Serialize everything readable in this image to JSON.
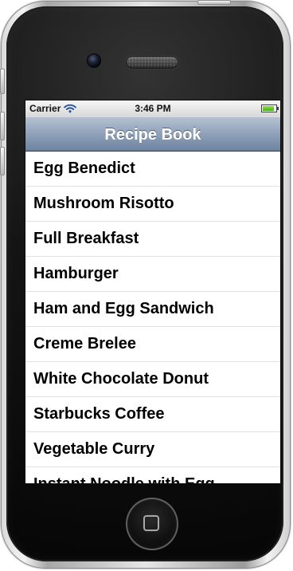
{
  "status_bar": {
    "carrier": "Carrier",
    "time": "3:46 PM",
    "battery_level": 0.9,
    "icons": {
      "wifi": "wifi-icon",
      "battery": "battery-icon"
    }
  },
  "navigation": {
    "title": "Recipe Book"
  },
  "recipes": [
    {
      "label": "Egg Benedict"
    },
    {
      "label": "Mushroom Risotto"
    },
    {
      "label": "Full Breakfast"
    },
    {
      "label": "Hamburger"
    },
    {
      "label": "Ham and Egg Sandwich"
    },
    {
      "label": "Creme Brelee"
    },
    {
      "label": "White Chocolate Donut"
    },
    {
      "label": "Starbucks Coffee"
    },
    {
      "label": "Vegetable Curry"
    },
    {
      "label": "Instant Noodle with Egg"
    }
  ],
  "device": {
    "controls": {
      "home_button": "home-button-icon"
    },
    "colors": {
      "nav_top": "#b4c1d2",
      "nav_bottom": "#6d83a0",
      "battery_green": "#46b118"
    }
  }
}
